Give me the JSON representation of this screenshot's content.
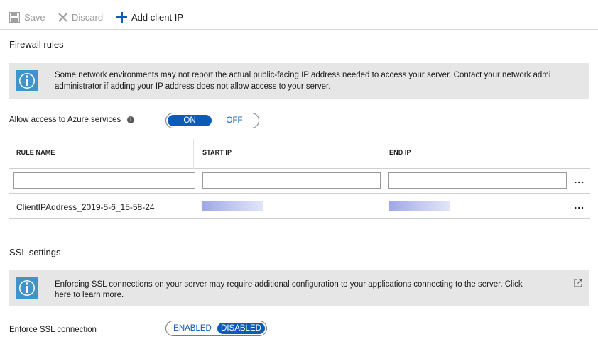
{
  "toolbar": {
    "save_label": "Save",
    "discard_label": "Discard",
    "add_client_ip_label": "Add client IP"
  },
  "firewall": {
    "title": "Firewall rules",
    "info_line1": "Some network environments may not report the actual public-facing IP address needed to access your server.  Contact your network admi",
    "info_line2": "administrator if adding your IP address does not allow access to your server.",
    "allow_azure_label": "Allow access to Azure services",
    "toggle_on": "ON",
    "toggle_off": "OFF",
    "allow_azure_state": "ON",
    "columns": [
      "RULE NAME",
      "START IP",
      "END IP"
    ],
    "new_rule": {
      "rule_name": "",
      "start_ip": "",
      "end_ip": ""
    },
    "rules": [
      {
        "rule_name": "ClientIPAddress_2019-5-6_15-58-24"
      }
    ],
    "more_label": "..."
  },
  "ssl": {
    "title": "SSL settings",
    "info_line1": "Enforcing SSL connections on your server may require additional configuration to your applications connecting to the server.  Click",
    "info_line2": "here to learn more.",
    "enforce_label": "Enforce SSL connection",
    "toggle_enabled": "ENABLED",
    "toggle_disabled": "DISABLED",
    "enforce_state": "DISABLED"
  },
  "icons": {
    "save": "save-icon",
    "discard": "close-icon",
    "add": "plus-icon",
    "info": "info-icon",
    "external_link": "external-link-icon"
  },
  "colors": {
    "accent": "#0b5cb8",
    "info_icon": "#3f95c9",
    "info_bar_bg": "#e6e6e6",
    "disabled_text": "#9a9a9a"
  }
}
